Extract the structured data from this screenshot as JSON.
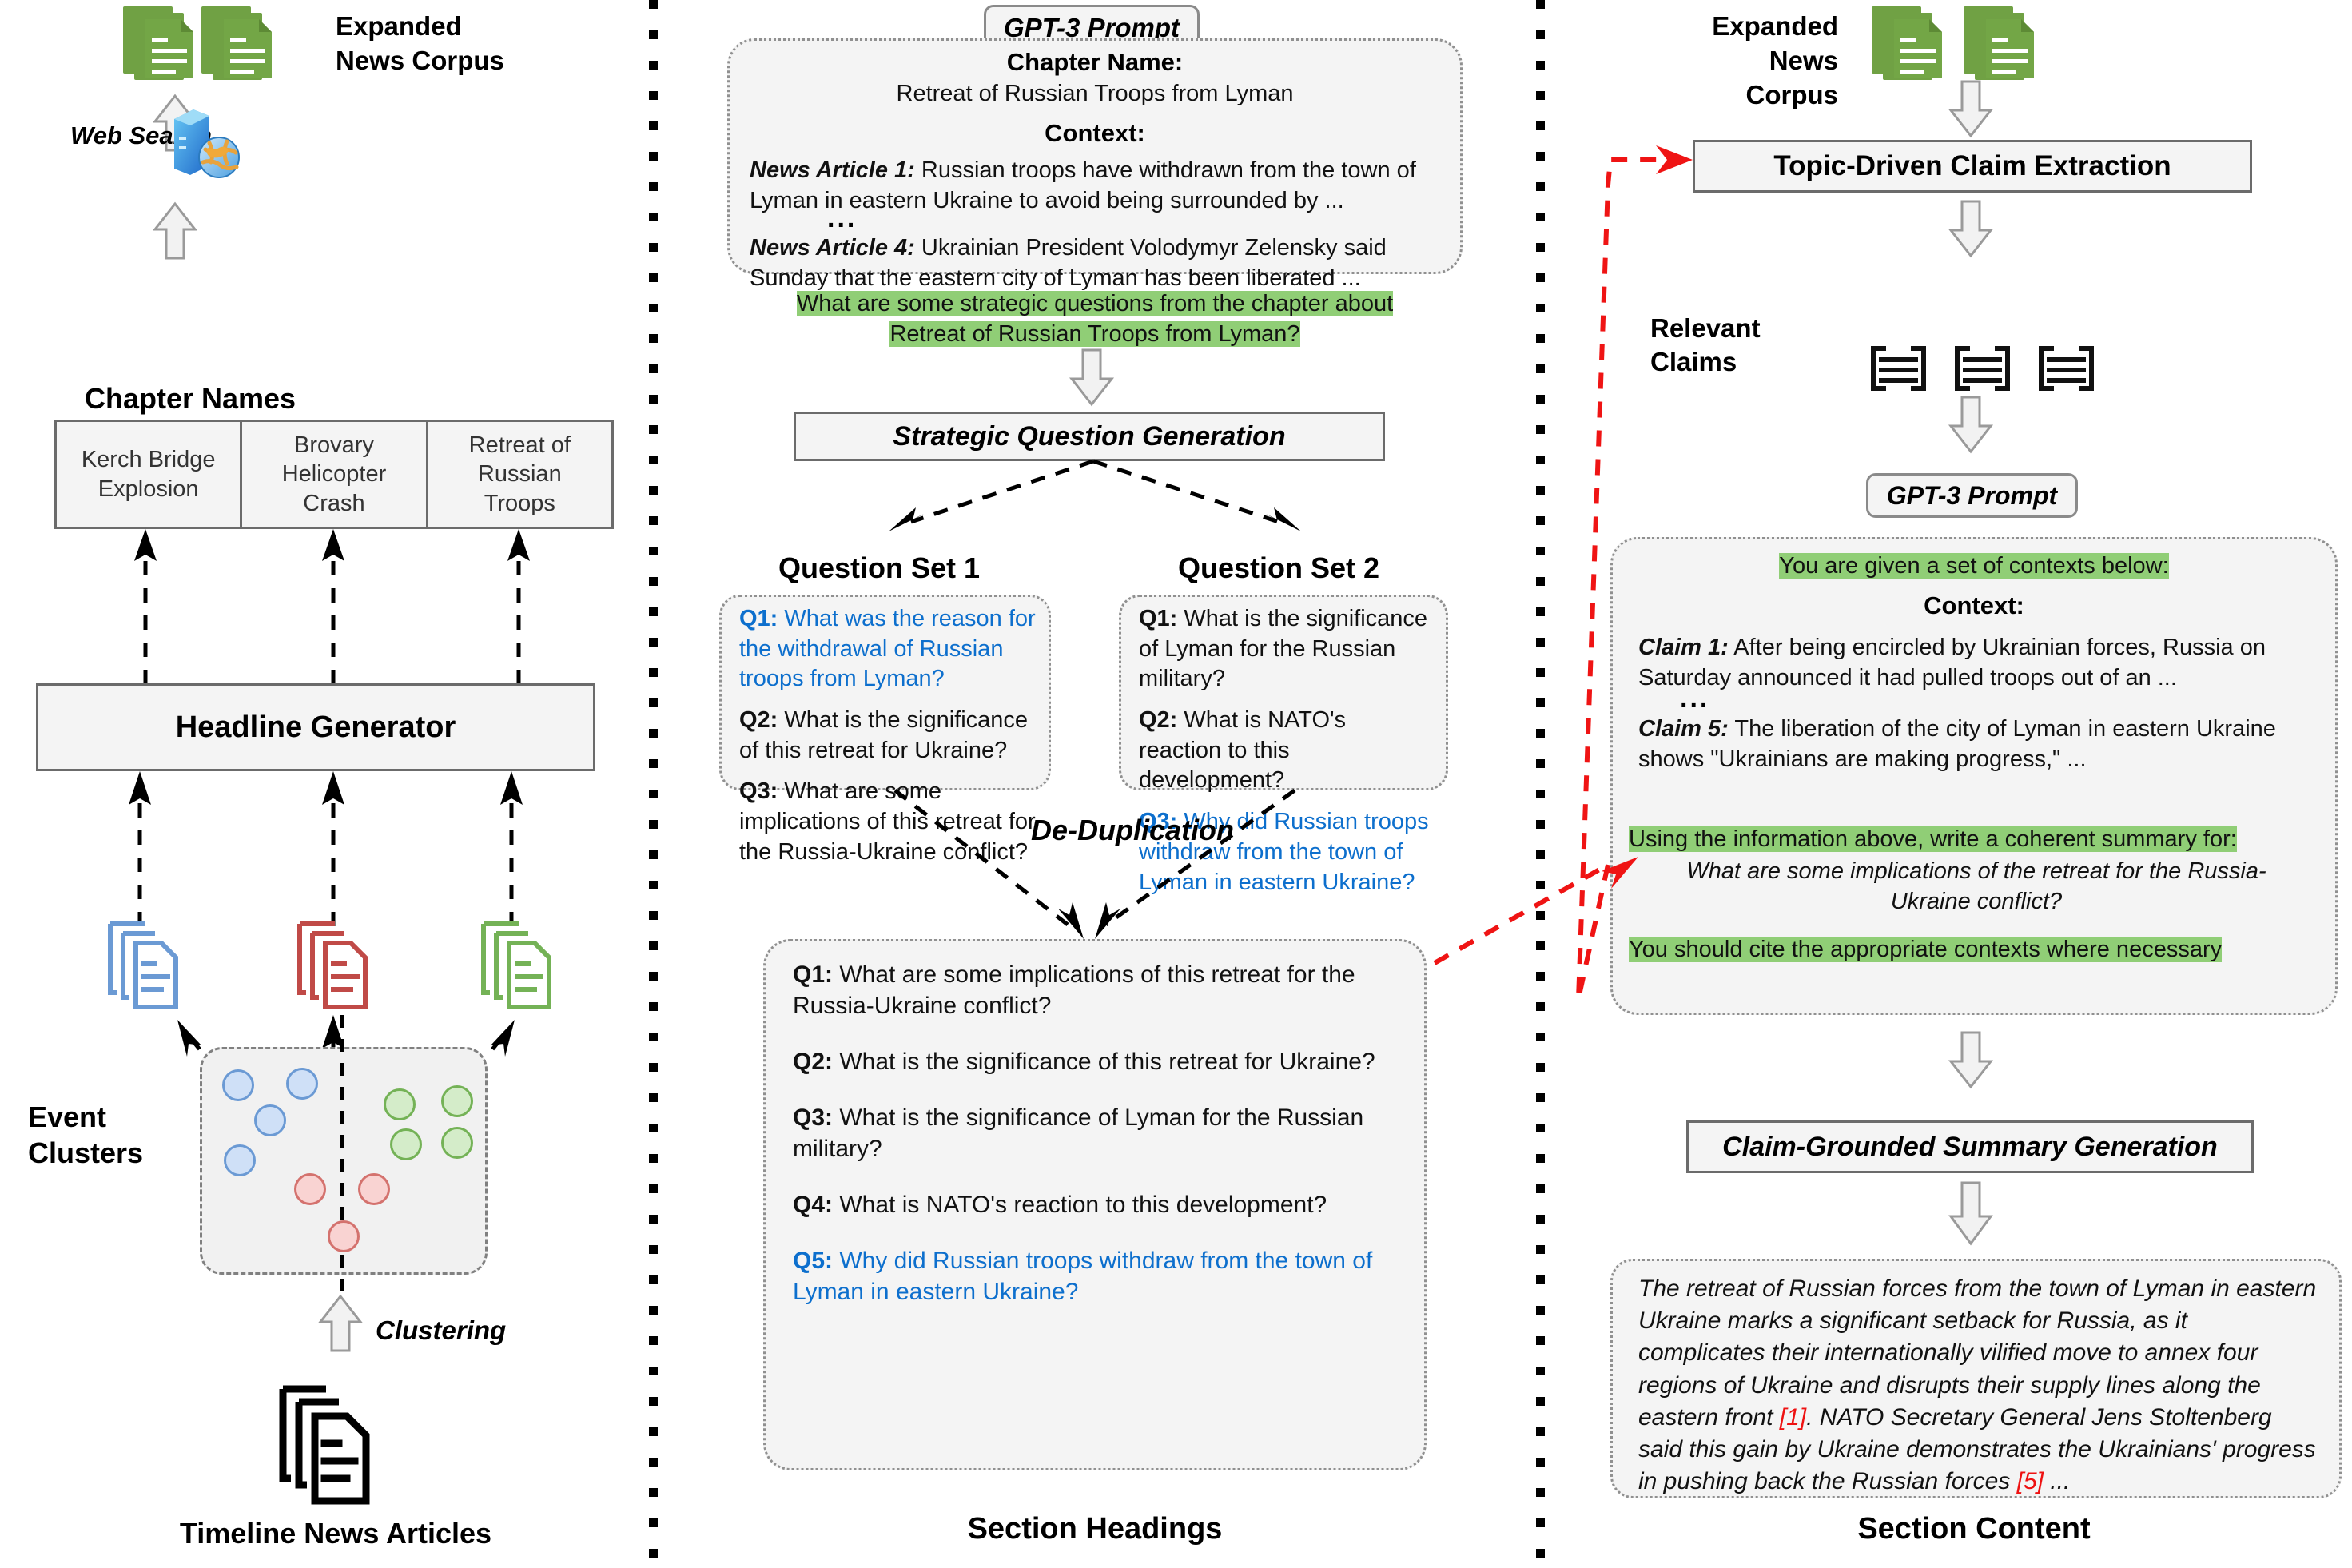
{
  "separators": {
    "count": 2
  },
  "left_panel": {
    "corpus_label": "Expanded\nNews Corpus",
    "corpus_label_line1": "Expanded",
    "corpus_label_line2": "News Corpus",
    "web_search_label": "Web Search",
    "chapter_names_title": "Chapter Names",
    "chapter_names": [
      "Kerch Bridge\nExplosion",
      "Brovary\nHelicopter\nCrash",
      "Retreat of\nRussian\nTroops"
    ],
    "chapter_name_1_l1": "Kerch Bridge",
    "chapter_name_1_l2": "Explosion",
    "chapter_name_2_l1": "Brovary",
    "chapter_name_2_l2": "Helicopter",
    "chapter_name_2_l3": "Crash",
    "chapter_name_3_l1": "Retreat of",
    "chapter_name_3_l2": "Russian",
    "chapter_name_3_l3": "Troops",
    "headline_generator": "Headline Generator",
    "event_clusters_l1": "Event",
    "event_clusters_l2": "Clusters",
    "clustering_label": "Clustering",
    "timeline_articles_label": "Timeline News Articles"
  },
  "middle_panel": {
    "prompt_badge": "GPT-3 Prompt",
    "chapter_name_heading": "Chapter Name:",
    "chapter_name_value": "Retreat of Russian Troops from Lyman",
    "context_heading": "Context:",
    "article_1_label": "News Article 1:",
    "article_1_text": " Russian troops have withdrawn from the town of Lyman in eastern Ukraine to avoid being surrounded by ...",
    "ellipsis": "...",
    "article_4_label": "News Article 4:",
    "article_4_text": " Ukrainian President Volodymyr Zelensky said Sunday that the eastern city of Lyman has been liberated ...",
    "highlight_question_l1": "What are some strategic questions from the chapter about",
    "highlight_question_l2": "Retreat of Russian Troops from Lyman?",
    "sqg_box": "Strategic Question Generation",
    "question_set_1_title": "Question Set 1",
    "question_set_2_title": "Question Set 2",
    "question_set_1": [
      {
        "label": "Q1:",
        "text": " What was the reason for the withdrawal of Russian troops from Lyman?",
        "highlighted": true
      },
      {
        "label": "Q2:",
        "text": " What is the significance of this retreat for Ukraine?",
        "highlighted": false
      },
      {
        "label": "Q3:",
        "text": " What are some implications of this retreat for the Russia-Ukraine conflict?",
        "highlighted": false
      }
    ],
    "question_set_2": [
      {
        "label": "Q1:",
        "text": " What is the significance of Lyman for the Russian military?",
        "highlighted": false
      },
      {
        "label": "Q2:",
        "text": " What is NATO's reaction to this development?",
        "highlighted": false
      },
      {
        "label": "Q3:",
        "text": " Why did Russian troops withdraw from the town of Lyman in eastern Ukraine?",
        "highlighted": true
      }
    ],
    "dedup_label": "De-Duplication",
    "final_questions": [
      {
        "label": "Q1:",
        "text": " What are some implications of this retreat for the Russia-Ukraine conflict?",
        "highlighted": false
      },
      {
        "label": "Q2:",
        "text": " What is the significance of this retreat for Ukraine?",
        "highlighted": false
      },
      {
        "label": "Q3:",
        "text": " What is the significance of Lyman for the Russian military?",
        "highlighted": false
      },
      {
        "label": "Q4:",
        "text": " What is NATO's reaction to this development?",
        "highlighted": false
      },
      {
        "label": "Q5:",
        "text": " Why did Russian troops withdraw from the town of Lyman in eastern Ukraine?",
        "highlighted": true
      }
    ],
    "footer_caption": "Section Headings"
  },
  "right_panel": {
    "corpus_label_line1": "Expanded",
    "corpus_label_line2": "News Corpus",
    "claim_extraction_box": "Topic-Driven Claim Extraction",
    "relevant_claims_l1": "Relevant",
    "relevant_claims_l2": "Claims",
    "prompt_badge": "GPT-3 Prompt",
    "highlight_contexts": "You are given a set of contexts below:",
    "context_heading": "Context:",
    "claim_1_label": "Claim 1:",
    "claim_1_text": "  After being encircled by Ukrainian forces, Russia on Saturday announced it had pulled troops out of an ...",
    "ellipsis": "...",
    "claim_5_label": "Claim 5:",
    "claim_5_text": " The liberation of the city of Lyman in eastern Ukraine shows \"Ukrainians are making progress,\"  ...",
    "highlight_instruction": "Using the information above, write a coherent summary for:",
    "summary_question_l1": "What are some implications of the retreat for the Russia-",
    "summary_question_l2": "Ukraine conflict?",
    "highlight_cite": "You should cite the appropriate contexts where necessary",
    "summary_generation_box": "Claim-Grounded Summary Generation",
    "section_content_text_a": "The retreat of Russian forces from the town of Lyman in eastern Ukraine marks a significant setback for Russia, as it complicates their internationally vilified move to annex four regions of Ukraine and disrupts their supply lines along the eastern front ",
    "section_content_cite_1": "[1]",
    "section_content_text_b": ". NATO Secretary General Jens Stoltenberg said this gain by Ukraine demonstrates the Ukrainians' progress in pushing back the Russian forces ",
    "section_content_cite_2": "[5]",
    "section_content_text_c": " ...",
    "footer_caption": "Section Content"
  },
  "colors": {
    "highlight_green": "#90ce76",
    "accent_blue": "#0d6fcd",
    "citation_red": "#ee1111",
    "doc_green": "#73a646",
    "cluster_blue": "#cfe0f7",
    "cluster_red": "#f9d3d2",
    "cluster_green": "#d4ecc9",
    "box_fill": "#f4f4f4",
    "box_border": "#6b6b6b"
  },
  "icons": {
    "web_search": "web-search-globe-server-icon",
    "documents": "document-stack-icon",
    "claims": "claim-bracket-icon"
  }
}
